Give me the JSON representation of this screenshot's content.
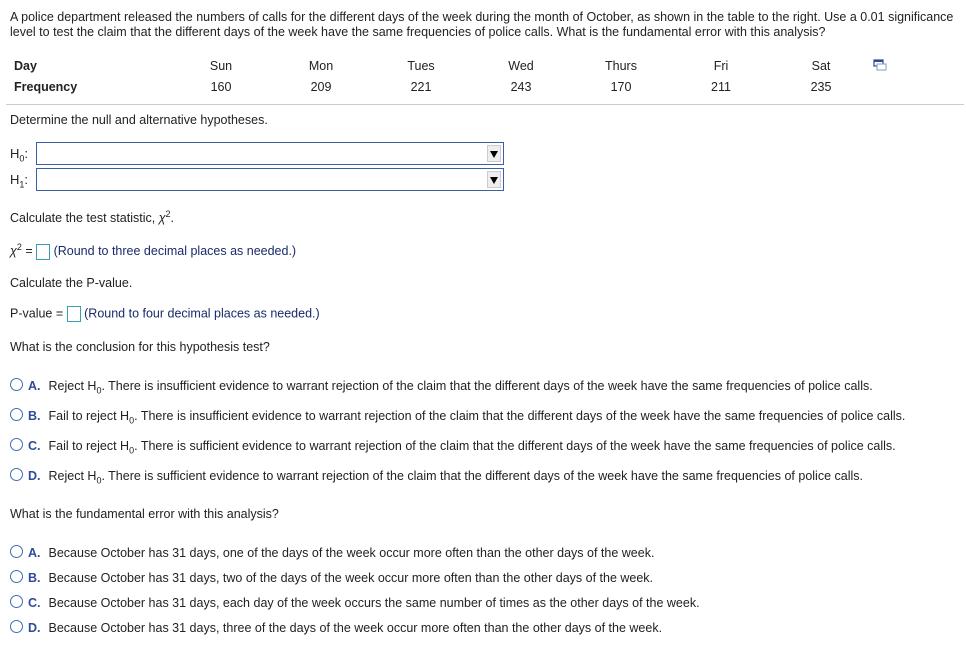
{
  "question": {
    "intro": "A police department released the numbers of calls for the different days of the week during the month of October, as shown in the table to the right. Use a 0.01 significance level to test the claim that the different days of the week have the same frequencies of police calls. What is the fundamental error with this analysis?"
  },
  "table": {
    "row_labels": [
      "Day",
      "Frequency"
    ],
    "days": [
      "Sun",
      "Mon",
      "Tues",
      "Wed",
      "Thurs",
      "Fri",
      "Sat"
    ],
    "frequencies": [
      "160",
      "209",
      "221",
      "243",
      "170",
      "211",
      "235"
    ],
    "copy_icon": "copy-table-icon"
  },
  "hypotheses": {
    "prompt": "Determine the null and alternative hypotheses.",
    "h0_label": "H",
    "h0_sub": "0",
    "h1_label": "H",
    "h1_sub": "1",
    "colon": ":",
    "h0_value": "",
    "h1_value": ""
  },
  "test_statistic": {
    "prompt_prefix": "Calculate the test statistic, ",
    "symbol": "χ",
    "sup": "2",
    "suffix": ".",
    "equals": " =",
    "value": "",
    "hint": "(Round to three decimal places as needed.)"
  },
  "p_value": {
    "prompt": "Calculate the P-value.",
    "label": "P-value =",
    "value": "",
    "hint": "(Round to four decimal places as needed.)"
  },
  "conclusion": {
    "prompt": "What is the conclusion for this hypothesis test?",
    "options": [
      {
        "letter": "A.",
        "pre": "Reject H",
        "sub": "0",
        "post": ". There is insufficient evidence to warrant rejection of the claim that the different days of the week have the same frequencies of police calls."
      },
      {
        "letter": "B.",
        "pre": "Fail to reject H",
        "sub": "0",
        "post": ". There is insufficient evidence to warrant rejection of the claim that the different days of the week have the same frequencies of police calls."
      },
      {
        "letter": "C.",
        "pre": "Fail to reject H",
        "sub": "0",
        "post": ". There is sufficient evidence to warrant rejection of the claim that the different days of the week have the same frequencies of police calls."
      },
      {
        "letter": "D.",
        "pre": "Reject H",
        "sub": "0",
        "post": ". There is sufficient evidence to warrant rejection of the claim that the different days of the week have the same frequencies of police calls."
      }
    ]
  },
  "error": {
    "prompt": "What is the fundamental error with this analysis?",
    "options": [
      {
        "letter": "A.",
        "text": "Because October has 31 days, one of the days of the week occur more often than the other days of the week."
      },
      {
        "letter": "B.",
        "text": "Because October has 31 days, two of the days of the week occur more often than the other days of the week."
      },
      {
        "letter": "C.",
        "text": "Because October has 31 days, each day of the week occurs the same number of times as the other days of the week."
      },
      {
        "letter": "D.",
        "text": "Because October has 31 days, three of the days of the week occur more often than the other days of the week."
      }
    ]
  }
}
